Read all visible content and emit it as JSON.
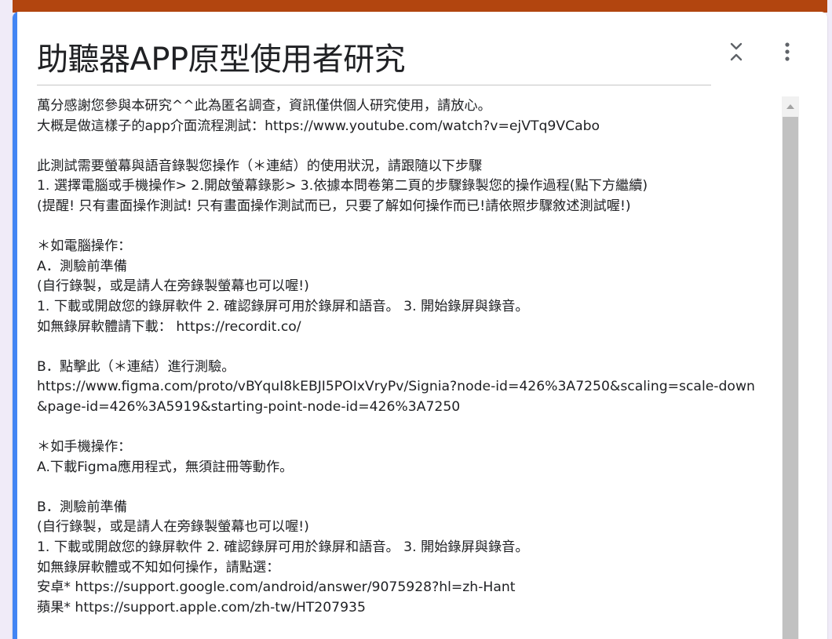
{
  "form": {
    "title": "助聽器APP原型使用者研究",
    "description": "萬分感謝您參與本研究^^此為匿名調查，資訊僅供個人研究使用，請放心。\n大概是做這樣子的app介面流程測試：https://www.youtube.com/watch?v=ejVTq9VCabo\n\n此測試需要螢幕與語音錄製您操作（＊連結）的使用狀況，請跟隨以下步驟\n1. 選擇電腦或手機操作> 2.開啟螢幕錄影> 3.依據本問卷第二頁的步驟錄製您的操作過程(點下方繼續)\n(提醒! 只有畫面操作測試! 只有畫面操作測試而已，只要了解如何操作而已!請依照步驟敘述測試喔!)\n\n＊如電腦操作：\nA．測驗前準備\n(自行錄製，或是請人在旁錄製螢幕也可以喔!)\n1. 下載或開啟您的錄屏軟件 2. 確認錄屏可用於錄屏和語音。 3. 開始錄屏與錄音。\n如無錄屏軟體請下載： https://recordit.co/\n\nB．點擊此（＊連結）進行測驗。\nhttps://www.figma.com/proto/vBYquI8kEBJI5POIxVryPv/Signia?node-id=426%3A7250&scaling=scale-down&page-id=426%3A5919&starting-point-node-id=426%3A7250\n\n＊如手機操作：\nA.下載Figma應用程式，無須註冊等動作。\n\nB．測驗前準備\n(自行錄製，或是請人在旁錄製螢幕也可以喔!)\n1. 下載或開啟您的錄屏軟件 2. 確認錄屏可用於錄屏和語音。 3. 開始錄屏與錄音。\n如無錄屏軟體或不知如何操作，請點選：\n安卓* https://support.google.com/android/answer/9075928?hl=zh-Hant\n蘋果* https://support.apple.com/zh-tw/HT207935"
  },
  "icons": {
    "collapse": "collapse-icon",
    "more": "more-vert-icon",
    "scroll_up": "scroll-up-arrow"
  },
  "colors": {
    "theme_header": "#b2450f",
    "left_accent": "#4285f4",
    "background": "#f0ebf8",
    "card": "#ffffff",
    "text": "#202124"
  }
}
